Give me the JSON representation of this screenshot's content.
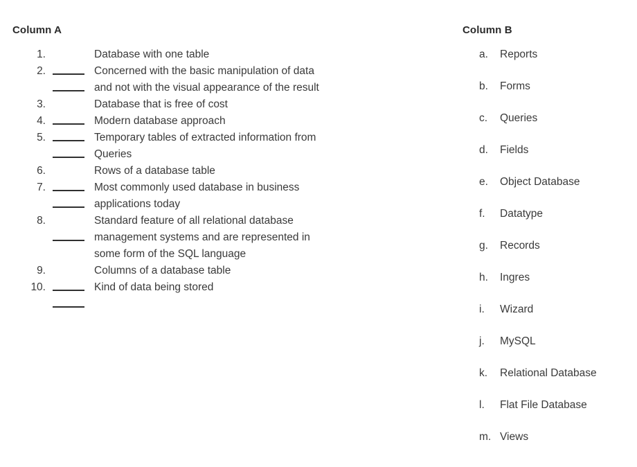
{
  "document": {
    "type": "matching-worksheet",
    "background_color": "#ffffff",
    "text_color": "#3a3a3a",
    "rule_color": "#2f2f2f"
  },
  "column_a": {
    "heading": "Column A",
    "items": [
      {
        "number": "1.",
        "text": "Database with one table"
      },
      {
        "number": "2.",
        "text": "Concerned with the basic manipulation of data\nand not with the visual appearance of the result"
      },
      {
        "number": "3.",
        "text": "Database that is free of cost"
      },
      {
        "number": "4.",
        "text": "Modern database approach"
      },
      {
        "number": "5.",
        "text": "Temporary tables of extracted information from\nQueries"
      },
      {
        "number": "6.",
        "text": "Rows of a database table"
      },
      {
        "number": "7.",
        "text": "Most commonly used database in business\napplications today"
      },
      {
        "number": "8.",
        "text": "Standard feature of all relational database\nmanagement systems and are represented in\nsome form of the SQL language"
      },
      {
        "number": "9.",
        "text": "Columns of a database table"
      },
      {
        "number": "10.",
        "text": "Kind of data being stored"
      }
    ]
  },
  "column_b": {
    "heading": "Column B",
    "items": [
      {
        "marker": "a.",
        "text": "Reports"
      },
      {
        "marker": "b.",
        "text": "Forms"
      },
      {
        "marker": "c.",
        "text": "Queries"
      },
      {
        "marker": "d.",
        "text": "Fields"
      },
      {
        "marker": "e.",
        "text": "Object Database"
      },
      {
        "marker": "f.",
        "text": "Datatype"
      },
      {
        "marker": "g.",
        "text": "Records"
      },
      {
        "marker": "h.",
        "text": "Ingres"
      },
      {
        "marker": "i.",
        "text": "Wizard"
      },
      {
        "marker": "j.",
        "text": "MySQL"
      },
      {
        "marker": "k.",
        "text": "Relational Database"
      },
      {
        "marker": "l.",
        "text": "Flat File Database"
      },
      {
        "marker": "m.",
        "text": "Views"
      }
    ]
  }
}
